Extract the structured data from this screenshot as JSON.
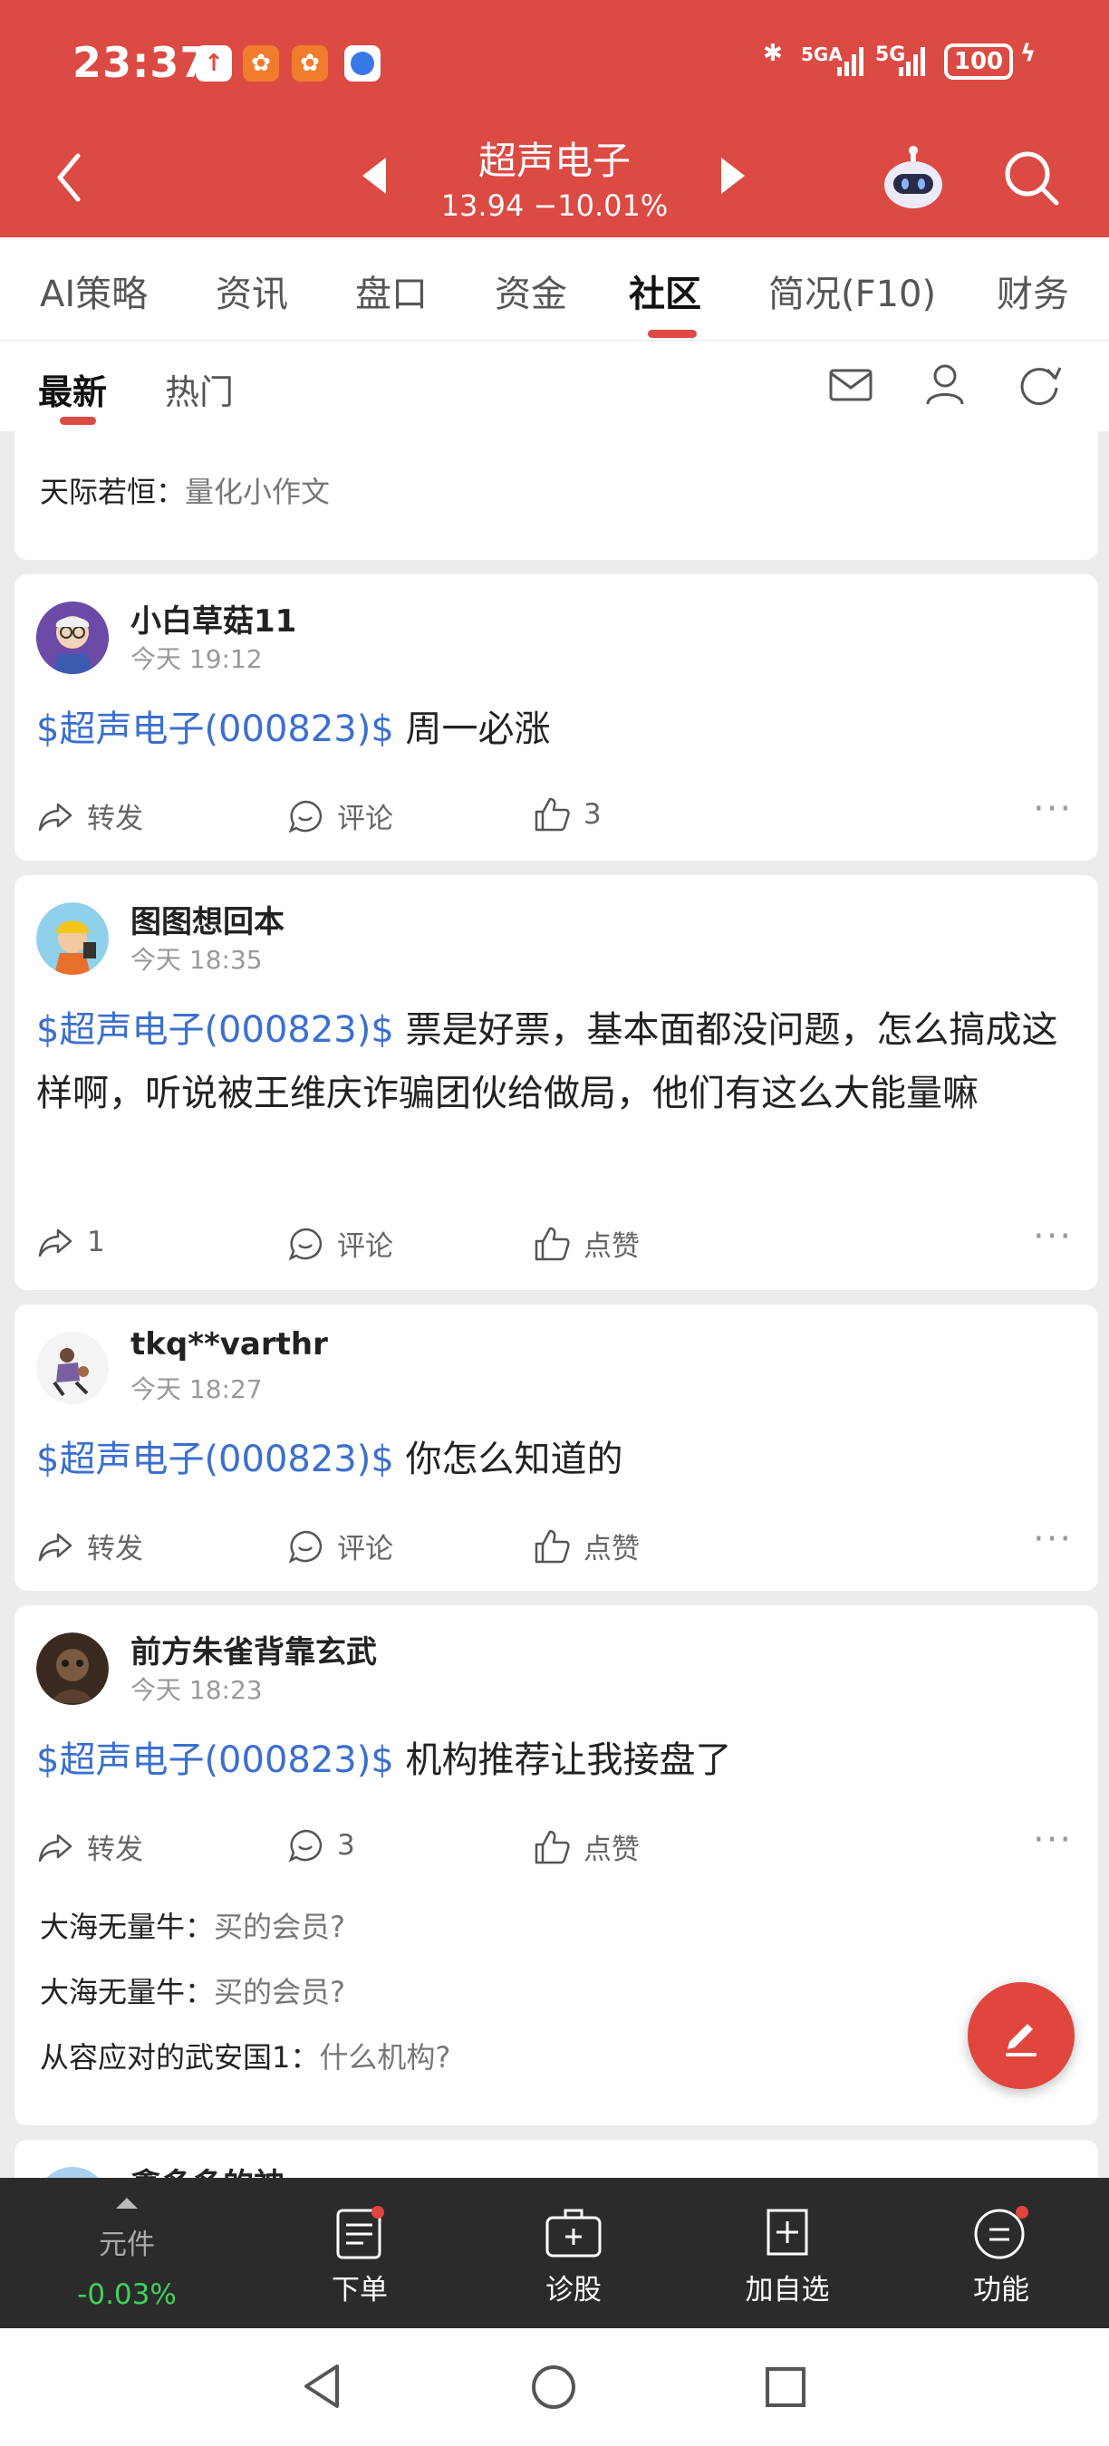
{
  "status": {
    "time": "23:37",
    "net1": "5GA",
    "net2": "5G",
    "battery": "100"
  },
  "header": {
    "title": "超声电子",
    "price_line": "13.94  −10.01%"
  },
  "tabs": [
    "AI策略",
    "资讯",
    "盘口",
    "资金",
    "社区",
    "简况(F10)",
    "财务"
  ],
  "subtabs": [
    "最新",
    "热门"
  ],
  "partial_comment": {
    "user": "天际若恒：",
    "text": "量化小作文"
  },
  "posts": [
    {
      "user": "小白草菇11",
      "time": "今天 19:12",
      "tag": "$超声电子(000823)$",
      "text": " 周一必涨",
      "share": "转发",
      "comment": "评论",
      "like": "3"
    },
    {
      "user": "图图想回本",
      "time": "今天 18:35",
      "tag": "$超声电子(000823)$",
      "text": " 票是好票，基本面都没问题，怎么搞成这样啊，听说被王维庆诈骗团伙给做局，他们有这么大能量嘛",
      "share": "1",
      "comment": "评论",
      "like": "点赞"
    },
    {
      "user": "tkq**varthr",
      "time": "今天 18:27",
      "tag": "$超声电子(000823)$",
      "text": " 你怎么知道的",
      "share": "转发",
      "comment": "评论",
      "like": "点赞"
    },
    {
      "user": "前方朱雀背靠玄武",
      "time": "今天 18:23",
      "tag": "$超声电子(000823)$",
      "text": " 机构推荐让我接盘了",
      "share": "转发",
      "comment": "3",
      "like": "点赞",
      "replies": [
        {
          "user": "大海无量牛：",
          "text": "买的会员?"
        },
        {
          "user": "大海无量牛：",
          "text": "买的会员?"
        },
        {
          "user": "从容应对的武安国1：",
          "text": "什么机构?"
        }
      ]
    }
  ],
  "next_user": "鑫多多的神",
  "bottom": {
    "index_name": "元件",
    "index_change": "-0.03%",
    "items": [
      "下单",
      "诊股",
      "加自选",
      "功能"
    ]
  },
  "colors": {
    "brand_red": "#dc4a44",
    "link_blue": "#3b6fcf",
    "up_green": "#3fd25a"
  }
}
